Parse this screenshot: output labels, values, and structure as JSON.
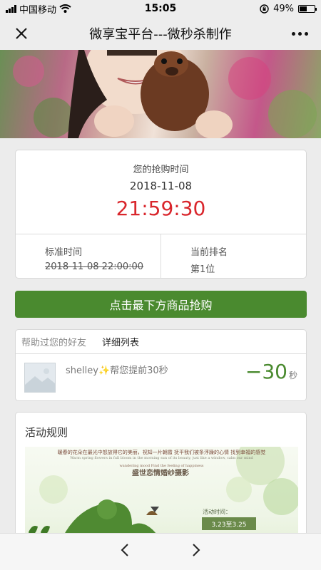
{
  "status_bar": {
    "carrier": "中国移动",
    "time": "15:05",
    "battery": "49%",
    "battery_level": 0.49
  },
  "nav": {
    "title": "微享宝平台---微秒杀制作",
    "close_icon": "close-icon",
    "more_icon": "more-icon"
  },
  "countdown_card": {
    "label": "您的抢购时间",
    "date": "2018-11-08",
    "time": "21:59:30",
    "standard_label": "标准时间",
    "standard_value": "2018-11-08 22:00:00",
    "rank_label": "当前排名",
    "rank_prefix": "第",
    "rank_number": "1",
    "rank_suffix": "位",
    "time_color": "#d9262c"
  },
  "buy_button": {
    "label": "点击最下方商品抢购",
    "color": "#4a8a2f"
  },
  "friends": {
    "tab_helped": "帮助过您的好友",
    "tab_detail": "详细列表",
    "items": [
      {
        "name": "shelley",
        "emoji": "✨",
        "text": "帮您提前30秒",
        "gain": "−30",
        "unit": "秒"
      }
    ]
  },
  "rules": {
    "title": "活动规则",
    "image": {
      "line1": "暖春的花朵在最光中怒放得它的美丽，祝知一片朝霞 抚平我们被条浮躁的心情 找到幸福的感觉",
      "line2": "Warm spring flowers in full bloom in the morning sun of its beauty, just like a window, calm our mind",
      "line3": "wandering mood Find the feeling of happiness",
      "headline": "盛世恋情婚纱摄影",
      "time_label": "活动时间：",
      "dates": "3.23至3.25"
    }
  },
  "bottom_bar": {
    "back_icon": "chevron-left-icon",
    "forward_icon": "chevron-right-icon"
  }
}
